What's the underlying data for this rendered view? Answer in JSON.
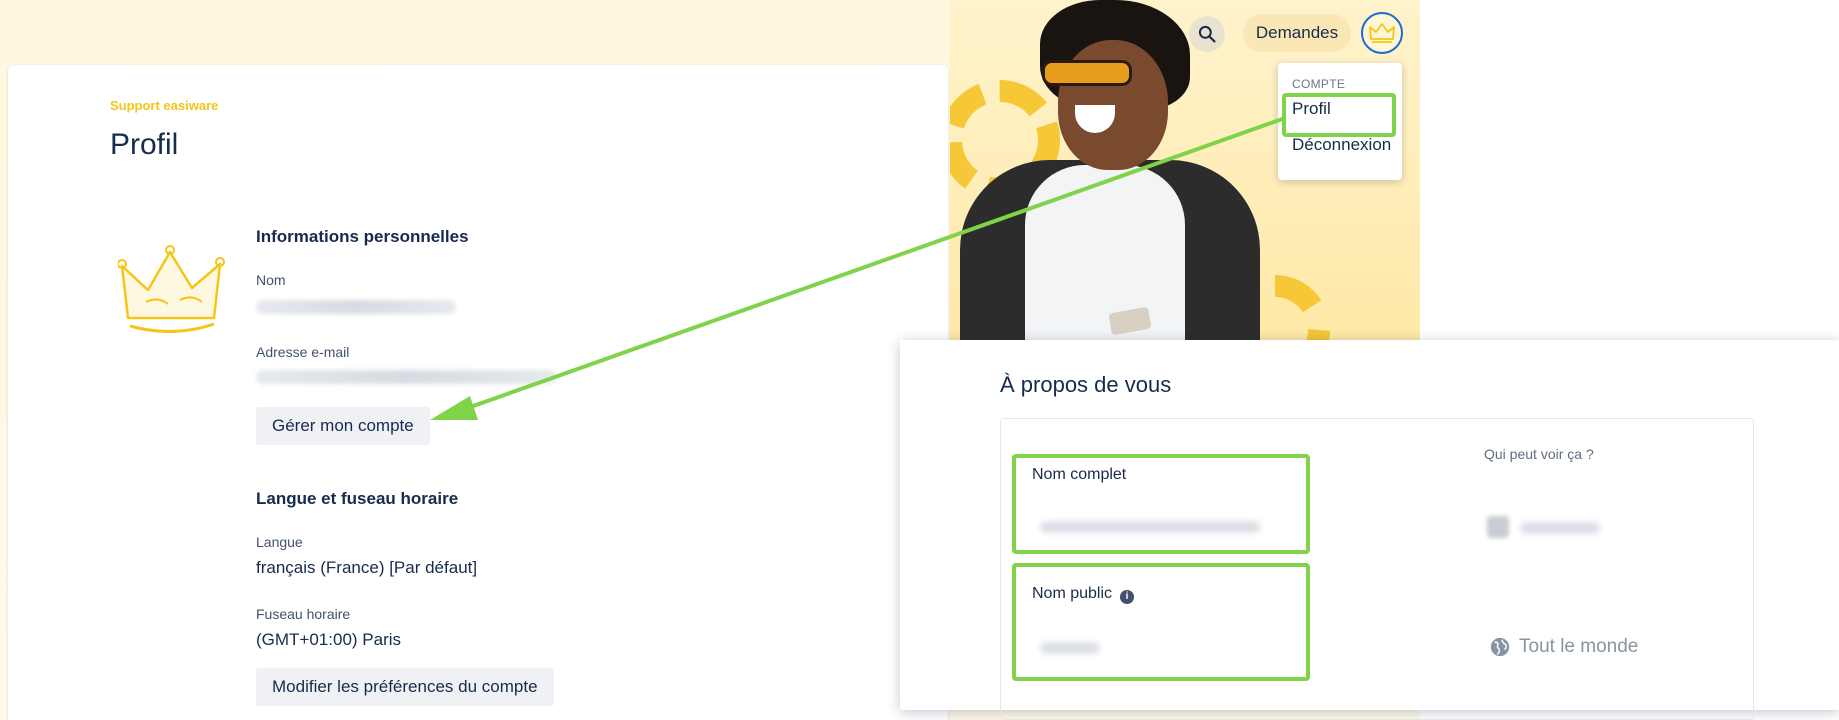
{
  "header": {
    "requests_label": "Demandes"
  },
  "dropdown": {
    "heading": "COMPTE",
    "items": [
      {
        "label": "Profil"
      },
      {
        "label": "Déconnexion"
      }
    ]
  },
  "profile": {
    "brand": "Support easiware",
    "title": "Profil",
    "personal": {
      "title": "Informations personnelles",
      "name_label": "Nom",
      "email_label": "Adresse e-mail",
      "manage_button": "Gérer mon compte"
    },
    "language": {
      "title": "Langue et fuseau horaire",
      "language_label": "Langue",
      "language_value": "français (France) [Par défaut]",
      "timezone_label": "Fuseau horaire",
      "timezone_value": "(GMT+01:00) Paris",
      "edit_button": "Modifier les préférences du compte"
    }
  },
  "about": {
    "title": "À propos de vous",
    "who_label": "Qui peut voir ça ?",
    "full_name_label": "Nom complet",
    "public_name_label": "Nom public",
    "public_name_info": "i",
    "visibility_everyone": "Tout le monde"
  },
  "colors": {
    "highlight": "#7ed348",
    "brand": "#f5c518",
    "avatar_ring": "#1e6bd6"
  }
}
